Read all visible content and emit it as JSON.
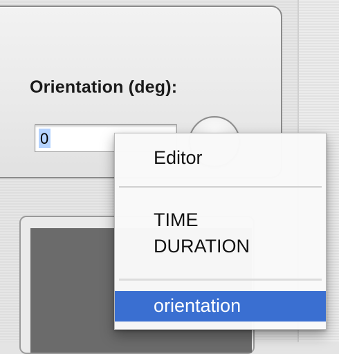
{
  "panel": {
    "orientation_label": "Orientation (deg):",
    "orientation_value": "0"
  },
  "context_menu": {
    "items": [
      {
        "label": "Editor",
        "selected": false
      },
      {
        "label": "TIME\nDURATION",
        "line1": "TIME",
        "line2": "DURATION",
        "selected": false
      },
      {
        "label": "orientation",
        "selected": true
      }
    ]
  },
  "colors": {
    "menu_highlight": "#3a6fd1",
    "text_selection": "#b5d3ff"
  },
  "icons": {
    "round_button": "circle-button-icon"
  }
}
